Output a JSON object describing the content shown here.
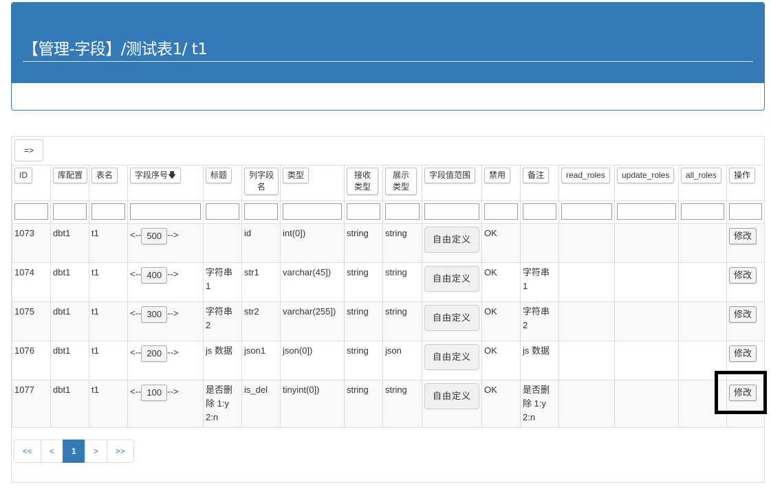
{
  "header": {
    "title": "【管理-字段】/测试表1/ t1"
  },
  "toolbar": {
    "toggle_label": "=>"
  },
  "columns": [
    {
      "label": "ID"
    },
    {
      "label": "库配置"
    },
    {
      "label": "表名"
    },
    {
      "label": "字段序号🡇"
    },
    {
      "label": "标题"
    },
    {
      "label": "列字段名"
    },
    {
      "label": "类型"
    },
    {
      "label": "接收类型"
    },
    {
      "label": "展示类型"
    },
    {
      "label": "字段值范围"
    },
    {
      "label": "禁用"
    },
    {
      "label": "备注"
    },
    {
      "label": "read_roles"
    },
    {
      "label": "update_roles"
    },
    {
      "label": "all_roles"
    },
    {
      "label": "操作"
    }
  ],
  "rows": [
    {
      "id": "1073",
      "db": "dbt1",
      "table": "t1",
      "order_prefix": "<--",
      "order": "500",
      "order_suffix": "-->",
      "title": "",
      "column": "id",
      "type": "int(0])",
      "recv": "string",
      "show": "string",
      "range": "自由定义",
      "disabled": "OK",
      "remark": "",
      "read_roles": "",
      "update_roles": "",
      "all_roles": "",
      "action": "修改"
    },
    {
      "id": "1074",
      "db": "dbt1",
      "table": "t1",
      "order_prefix": "<--",
      "order": "400",
      "order_suffix": "-->",
      "title": "字符串 1",
      "column": "str1",
      "type": "varchar(45])",
      "recv": "string",
      "show": "string",
      "range": "自由定义",
      "disabled": "OK",
      "remark": "字符串 1",
      "read_roles": "",
      "update_roles": "",
      "all_roles": "",
      "action": "修改"
    },
    {
      "id": "1075",
      "db": "dbt1",
      "table": "t1",
      "order_prefix": "<--",
      "order": "300",
      "order_suffix": "-->",
      "title": "字符串 2",
      "column": "str2",
      "type": "varchar(255])",
      "recv": "string",
      "show": "string",
      "range": "自由定义",
      "disabled": "OK",
      "remark": "字符串 2",
      "read_roles": "",
      "update_roles": "",
      "all_roles": "",
      "action": "修改"
    },
    {
      "id": "1076",
      "db": "dbt1",
      "table": "t1",
      "order_prefix": "<--",
      "order": "200",
      "order_suffix": "-->",
      "title": "js 数据",
      "column": "json1",
      "type": "json(0])",
      "recv": "string",
      "show": "json",
      "range": "自由定义",
      "disabled": "OK",
      "remark": "js 数据",
      "read_roles": "",
      "update_roles": "",
      "all_roles": "",
      "action": "修改"
    },
    {
      "id": "1077",
      "db": "dbt1",
      "table": "t1",
      "order_prefix": "<--",
      "order": "100",
      "order_suffix": "-->",
      "title": "是否删除 1:y 2:n",
      "column": "is_del",
      "type": "tinyint(0])",
      "recv": "string",
      "show": "string",
      "range": "自由定义",
      "disabled": "OK",
      "remark": "是否删除 1:y 2:n",
      "read_roles": "",
      "update_roles": "",
      "all_roles": "",
      "action": "修改"
    }
  ],
  "pagination": {
    "first": "<<",
    "prev": "<",
    "current": "1",
    "next": ">",
    "last": ">>"
  }
}
